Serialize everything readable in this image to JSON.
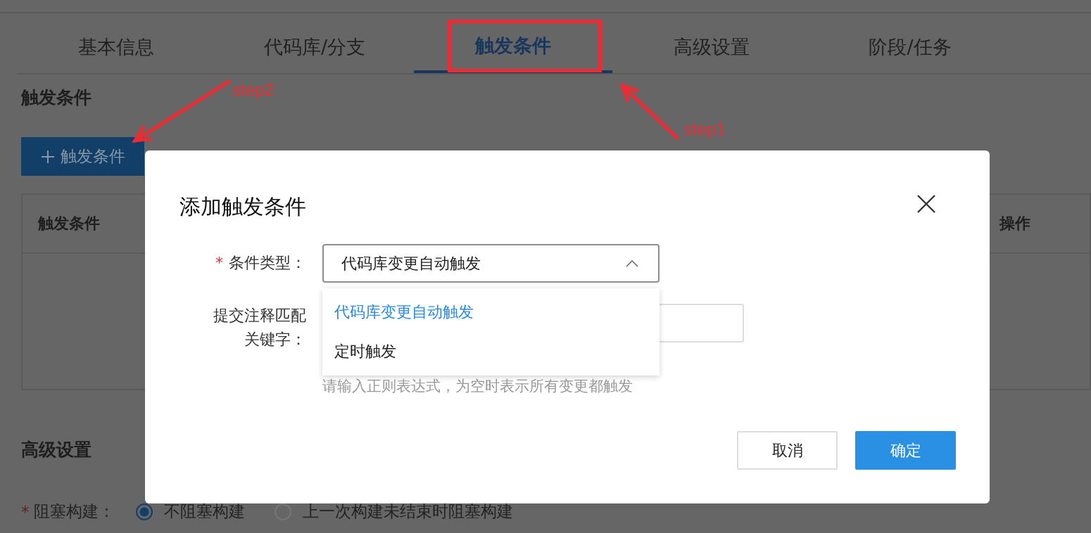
{
  "tabs": [
    {
      "label": "基本信息",
      "selected": false
    },
    {
      "label": "代码库/分支",
      "selected": false
    },
    {
      "label": "触发条件",
      "selected": true
    },
    {
      "label": "高级设置",
      "selected": false
    },
    {
      "label": "阶段/任务",
      "selected": false
    }
  ],
  "trigger_section": {
    "title": "触发条件",
    "add_button": "触发条件",
    "table_columns": [
      "触发条件",
      "操作"
    ]
  },
  "advanced_section": {
    "title": "高级设置",
    "field": {
      "required_mark": "*",
      "label": "阻塞构建：",
      "options": [
        {
          "label": "不阻塞构建",
          "selected": true
        },
        {
          "label": "上一次构建未结束时阻塞构建",
          "selected": false
        }
      ]
    }
  },
  "dialog": {
    "title": "添加触发条件",
    "fields": [
      {
        "kind": "select",
        "required_mark": "*",
        "label_lines": [
          "条件类型："
        ],
        "value": "代码库变更自动触发",
        "expanded": true,
        "options": [
          {
            "label": "代码库变更自动触发",
            "selected": true
          },
          {
            "label": "定时触发",
            "selected": false
          }
        ]
      },
      {
        "kind": "text",
        "label_lines": [
          "提交注释匹配",
          "关键字："
        ],
        "hint": "请输入正则表达式，为空时表示所有变更都触发"
      }
    ],
    "buttons": [
      {
        "kind": "secondary",
        "label": "取消"
      },
      {
        "kind": "primary",
        "label": "确定"
      }
    ]
  },
  "annotations": [
    {
      "kind": "box"
    },
    {
      "kind": "arrow",
      "label": "step1"
    },
    {
      "kind": "arrow",
      "label": "step2"
    }
  ]
}
